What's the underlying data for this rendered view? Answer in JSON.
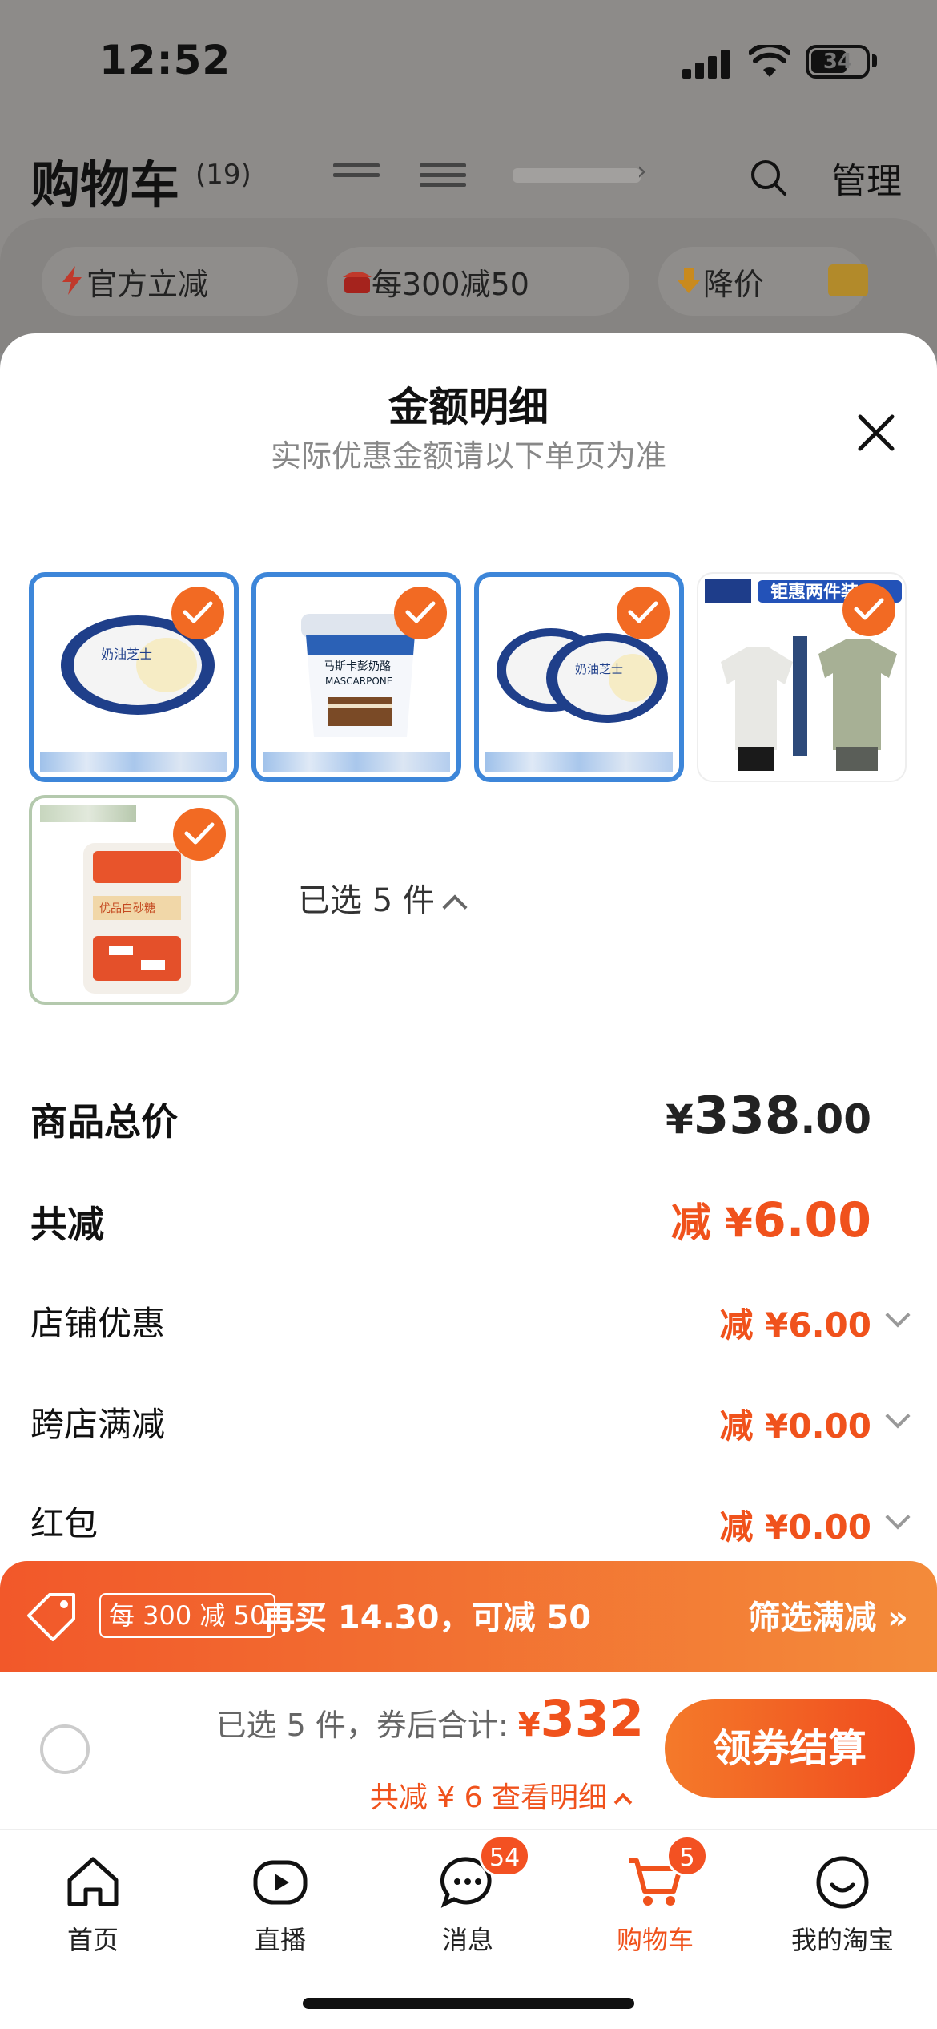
{
  "status_bar": {
    "time": "12:52",
    "battery": "34"
  },
  "header": {
    "title": "购物车",
    "count": "(19)",
    "manage": "管理"
  },
  "filters": [
    {
      "label": "官方立减"
    },
    {
      "label": "每300减50"
    },
    {
      "label": "降价"
    }
  ],
  "sheet": {
    "title": "金额明细",
    "subtitle": "实际优惠金额请以下单页为准",
    "products": [
      {
        "label": "奶油芝士"
      },
      {
        "label": "马斯卡彭奶酪",
        "sublabel": "MASCARPONE"
      },
      {
        "label": "奶油芝士"
      },
      {
        "label": "钜惠两件装"
      },
      {
        "label": "优品白砂糖"
      }
    ],
    "selected_count": "已选 5 件",
    "rows": {
      "total_label": "商品总价",
      "total_currency": "¥",
      "total_int": "338",
      "total_dec": ".00",
      "discount_label": "共减",
      "discount_prefix": "减 ¥",
      "discount_value": "6.00",
      "shop_label": "店铺优惠",
      "shop_value": "减 ¥6.00",
      "cross_label": "跨店满减",
      "cross_value": "减 ¥0.00",
      "redpacket_label": "红包",
      "redpacket_value": "减 ¥0.00"
    }
  },
  "promo": {
    "tag": "每 300 减 50",
    "text": "再买 14.30，可减 50",
    "link": "筛选满减 »"
  },
  "checkout": {
    "summary_prefix": "已选 5 件，券后合计:",
    "yen": "¥",
    "amount": "332",
    "detail": "共减 ¥ 6  查看明细",
    "button": "领券结算"
  },
  "tabs": [
    {
      "label": "首页",
      "icon": "home-icon"
    },
    {
      "label": "直播",
      "icon": "live-icon"
    },
    {
      "label": "消息",
      "icon": "message-icon",
      "badge": "54"
    },
    {
      "label": "购物车",
      "icon": "cart-icon",
      "badge": "5"
    },
    {
      "label": "我的淘宝",
      "icon": "profile-icon"
    }
  ],
  "colors": {
    "accent": "#f0521c",
    "selected_border": "#3d86d9"
  }
}
